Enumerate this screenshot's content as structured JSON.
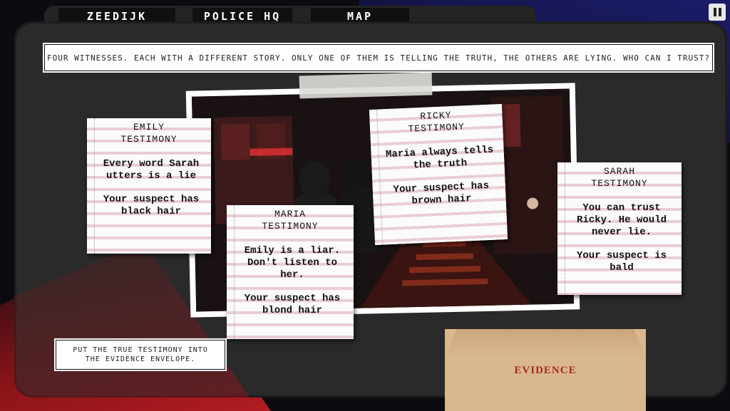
{
  "tabs": [
    "ZEEDIJK",
    "POLICE HQ",
    "MAP"
  ],
  "banner": "FOUR WITNESSES. EACH WITH A DIFFERENT STORY. ONLY ONE OF THEM IS TELLING THE TRUTH, THE OTHERS ARE LYING. WHO CAN I TRUST?",
  "hint": {
    "line1": "PUT THE TRUE TESTIMONY INTO",
    "line2": "THE EVIDENCE ENVELOPE."
  },
  "envelope_label": "EVIDENCE",
  "testimonies": {
    "emily": {
      "name": "EMILY",
      "heading": "TESTIMONY",
      "statement": "Every word Sarah utters is a lie",
      "clue": "Your suspect has black hair"
    },
    "maria": {
      "name": "MARIA",
      "heading": "TESTIMONY",
      "statement": "Emily is a liar. Don't listen to her.",
      "clue": "Your suspect has blond hair"
    },
    "ricky": {
      "name": "RICKY",
      "heading": "TESTIMONY",
      "statement": "Maria always tells the truth",
      "clue": "Your suspect has brown hair"
    },
    "sarah": {
      "name": "SARAH",
      "heading": "TESTIMONY",
      "statement": "You can trust Ricky. He would never lie.",
      "clue": "Your suspect is bald"
    }
  },
  "icons": {
    "pause": "pause-icon"
  },
  "colors": {
    "board": "#2a2a2a",
    "note_stripe": "#eacdd4",
    "envelope": "#d9b88f",
    "evidence_text": "#a32a25"
  }
}
